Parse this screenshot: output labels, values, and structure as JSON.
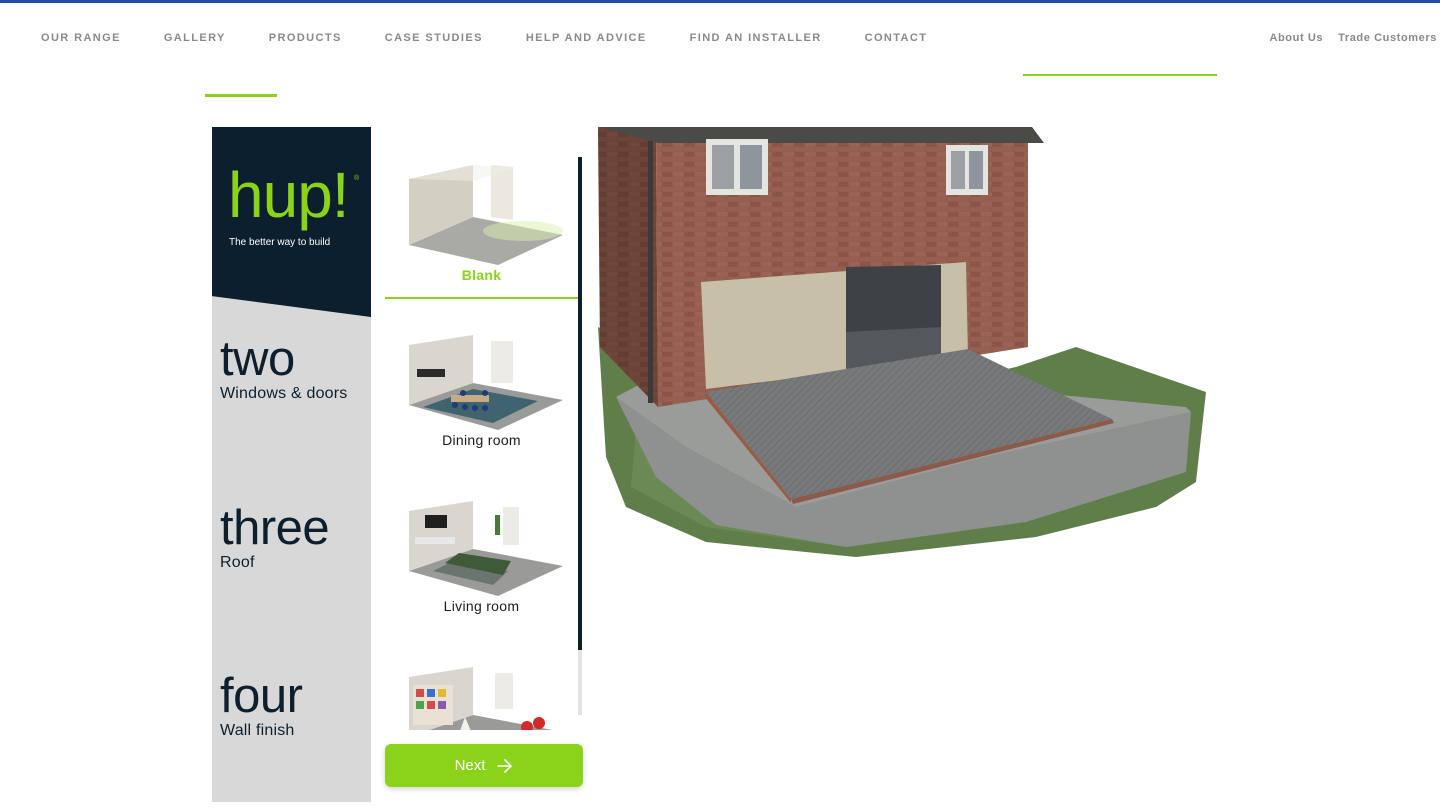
{
  "nav": {
    "items": [
      "OUR RANGE",
      "GALLERY",
      "PRODUCTS",
      "CASE STUDIES",
      "HELP AND ADVICE",
      "FIND AN INSTALLER",
      "CONTACT"
    ],
    "right_items": [
      "About Us",
      "Trade Customers"
    ]
  },
  "logo": {
    "wordmark": "hup!",
    "registered": "®",
    "tagline": "The better way  to build"
  },
  "steps": [
    {
      "number": "two",
      "label": "Windows & doors"
    },
    {
      "number": "three",
      "label": "Roof"
    },
    {
      "number": "four",
      "label": "Wall finish"
    }
  ],
  "rooms": [
    {
      "label": "Blank",
      "selected": true
    },
    {
      "label": "Dining room",
      "selected": false
    },
    {
      "label": "Living room",
      "selected": false
    },
    {
      "label": "",
      "selected": false
    }
  ],
  "next_button": {
    "label": "Next",
    "icon": "arrow-right-icon"
  },
  "colors": {
    "accent": "#8bd31a",
    "navy": "#0b1f2e",
    "topline": "#1f4ea3"
  }
}
